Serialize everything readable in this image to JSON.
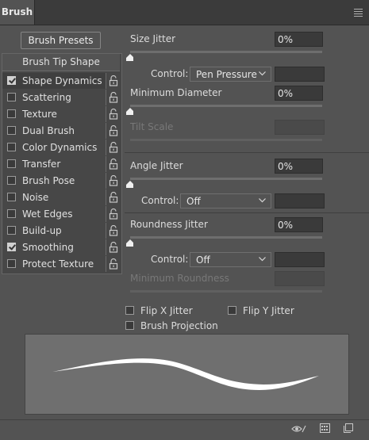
{
  "panel": {
    "tab_label": "Brush"
  },
  "presets_button": "Brush Presets",
  "tip_shape_header": "Brush Tip Shape",
  "options": [
    {
      "label": "Shape Dynamics",
      "checked": true,
      "selected": true
    },
    {
      "label": "Scattering",
      "checked": false
    },
    {
      "label": "Texture",
      "checked": false
    },
    {
      "label": "Dual Brush",
      "checked": false
    },
    {
      "label": "Color Dynamics",
      "checked": false
    },
    {
      "label": "Transfer",
      "checked": false
    },
    {
      "label": "Brush Pose",
      "checked": false
    },
    {
      "label": "Noise",
      "checked": false
    },
    {
      "label": "Wet Edges",
      "checked": false
    },
    {
      "label": "Build-up",
      "checked": false
    },
    {
      "label": "Smoothing",
      "checked": true
    },
    {
      "label": "Protect Texture",
      "checked": false
    }
  ],
  "size_jitter": {
    "label": "Size Jitter",
    "value": "0%",
    "control_label": "Control:",
    "control_value": "Pen Pressure"
  },
  "minimum_diameter": {
    "label": "Minimum Diameter",
    "value": "0%"
  },
  "tilt_scale": {
    "label": "Tilt Scale"
  },
  "angle_jitter": {
    "label": "Angle Jitter",
    "value": "0%",
    "control_label": "Control:",
    "control_value": "Off"
  },
  "roundness_jitter": {
    "label": "Roundness Jitter",
    "value": "0%",
    "control_label": "Control:",
    "control_value": "Off"
  },
  "minimum_roundness": {
    "label": "Minimum Roundness"
  },
  "flip_x": {
    "label": "Flip X Jitter",
    "checked": false
  },
  "flip_y": {
    "label": "Flip Y Jitter",
    "checked": false
  },
  "brush_projection": {
    "label": "Brush Projection",
    "checked": false
  },
  "icons": [
    "lock-icon",
    "checkbox-checked",
    "chevron-down-icon",
    "slider-thumb-icon",
    "eye-toggle-icon",
    "grid-panel-icon",
    "new-preset-icon",
    "panel-menu-icon"
  ]
}
